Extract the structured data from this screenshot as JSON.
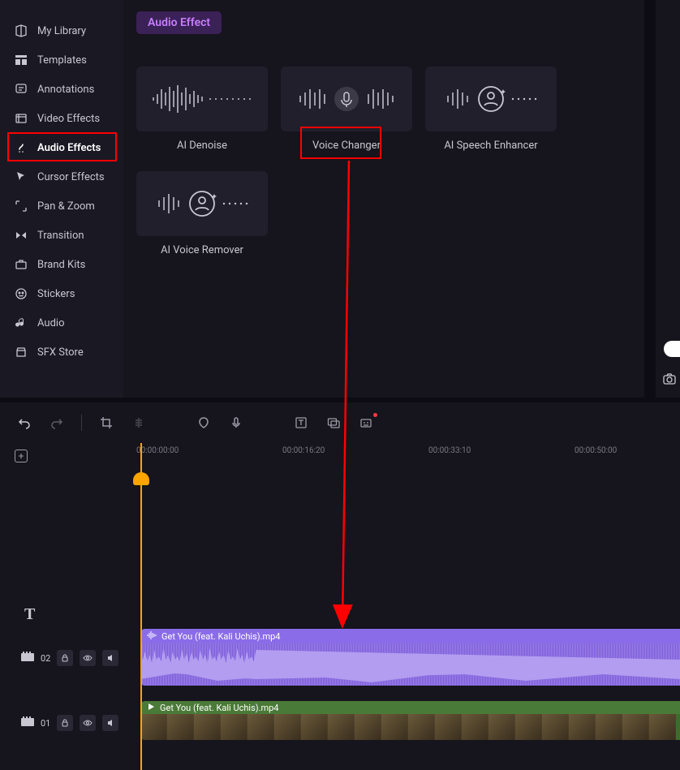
{
  "sidebar": {
    "items": [
      {
        "label": "My Library",
        "icon": "library"
      },
      {
        "label": "Templates",
        "icon": "templates"
      },
      {
        "label": "Annotations",
        "icon": "annotations"
      },
      {
        "label": "Video Effects",
        "icon": "video-fx"
      },
      {
        "label": "Audio Effects",
        "icon": "audio-fx",
        "active": true
      },
      {
        "label": "Cursor Effects",
        "icon": "cursor-fx"
      },
      {
        "label": "Pan & Zoom",
        "icon": "pan-zoom"
      },
      {
        "label": "Transition",
        "icon": "transition"
      },
      {
        "label": "Brand Kits",
        "icon": "brand"
      },
      {
        "label": "Stickers",
        "icon": "stickers"
      },
      {
        "label": "Audio",
        "icon": "audio"
      },
      {
        "label": "SFX Store",
        "icon": "sfx"
      }
    ]
  },
  "panel": {
    "title": "Audio Effect",
    "effects": [
      {
        "label": "AI Denoise"
      },
      {
        "label": "Voice Changer"
      },
      {
        "label": "AI Speech Enhancer"
      },
      {
        "label": "AI Voice Remover"
      }
    ]
  },
  "timeline": {
    "ruler": [
      "00:00:00:00",
      "00:00:16:20",
      "00:00:33:10",
      "00:00:50:00"
    ],
    "tracks": {
      "t02": {
        "num": "02"
      },
      "t01": {
        "num": "01"
      }
    },
    "audio_clip": {
      "filename": "Get You (feat. Kali Uchis).mp4"
    },
    "video_clip": {
      "filename": "Get You (feat. Kali Uchis).mp4"
    }
  }
}
